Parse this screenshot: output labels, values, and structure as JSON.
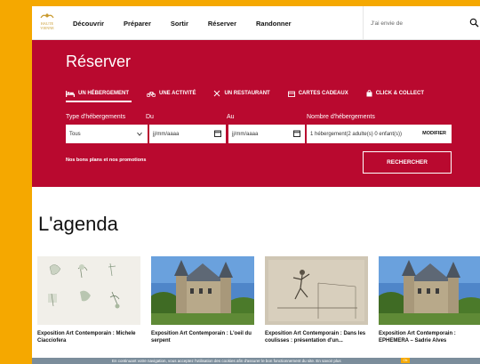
{
  "header": {
    "nav": [
      "Découvrir",
      "Préparer",
      "Sortir",
      "Réserver",
      "Randonner"
    ],
    "search_placeholder": "J'ai envie de"
  },
  "booking": {
    "title": "Réserver",
    "tabs": [
      "UN HÉBERGEMENT",
      "UNE ACTIVITÉ",
      "UN RESTAURANT",
      "CARTES CADEAUX",
      "CLICK & COLLECT"
    ],
    "labels": {
      "type": "Type d'hébergements",
      "from": "Du",
      "to": "Au",
      "count": "Nombre d'hébergements"
    },
    "fields": {
      "type_value": "Tous",
      "from_value": "jj/mm/aaaa",
      "to_value": "jj/mm/aaaa",
      "count_value": "1 hébergement(2 adulte(s) 0 enfant(s))",
      "modify_label": "MODIFIER"
    },
    "promo_link": "Nos bons plans et nos promotions",
    "search_button": "RECHERCHER"
  },
  "agenda": {
    "title": "L'agenda",
    "cards": [
      {
        "title": "Exposition Art Contemporain : Michele Ciacciofera",
        "image": "botanical-drawings"
      },
      {
        "title": "Exposition Art Contemporain : L'oeil du serpent",
        "image": "chateau"
      },
      {
        "title": "Exposition Art Contemporain : Dans les coulisses : présentation d'un...",
        "image": "tennis-sketch"
      },
      {
        "title": "Exposition Art Contemporain : EPHEMERA – Sadrie Alves",
        "image": "chateau"
      }
    ]
  },
  "cookie": {
    "text": "En continuant votre navigation, vous acceptez l'utilisation des cookies afin d'assurer le bon fonctionnement du site. En savoir plus",
    "ok_label": "Ok"
  },
  "colors": {
    "accent": "#b9092f",
    "frame": "#f5a800"
  }
}
